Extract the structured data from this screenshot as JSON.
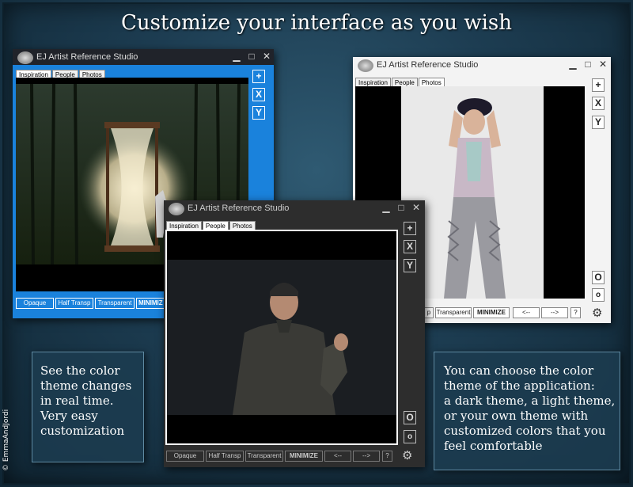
{
  "headline": "Customize your interface as you wish",
  "credit": "© EmmaAndJordi",
  "app_title": "EJ Artist Reference Studio",
  "window_controls": {
    "minimize": "▁",
    "maximize": "□",
    "close": "✕"
  },
  "tabs": [
    "Inspiration",
    "People",
    "Photos"
  ],
  "side_buttons": {
    "add": "+",
    "x": "X",
    "y": "Y",
    "o_large": "O",
    "o_small": "o"
  },
  "bottom_buttons": {
    "opaque": "Opaque",
    "half_transp": "Half Transp",
    "transparent": "Transparent",
    "minimize": "MINIMIZE",
    "prev": "<--",
    "next": "-->",
    "help": "?",
    "partial_half": "p",
    "partial_minimize": "MINIMIZ"
  },
  "windows": {
    "blue": {
      "theme": "blue",
      "accent": "#1a82dc",
      "active_tab": "Inspiration",
      "image": "hourglass-forest"
    },
    "light": {
      "theme": "light",
      "accent": "#f3f3f3",
      "active_tab": "Photos",
      "image": "dancer-woman"
    },
    "dark": {
      "theme": "dark",
      "accent": "#2d2d2d",
      "active_tab": "People",
      "image": "man-portrait"
    }
  },
  "info_left": {
    "lines": [
      "See the color",
      "theme changes",
      "in real time.",
      "Very easy",
      "customization"
    ]
  },
  "info_right": {
    "lines": [
      "You can choose the color",
      "theme of the application:",
      "a dark theme, a light theme,",
      "or your own theme with",
      "customized colors that you",
      "feel comfortable"
    ]
  }
}
